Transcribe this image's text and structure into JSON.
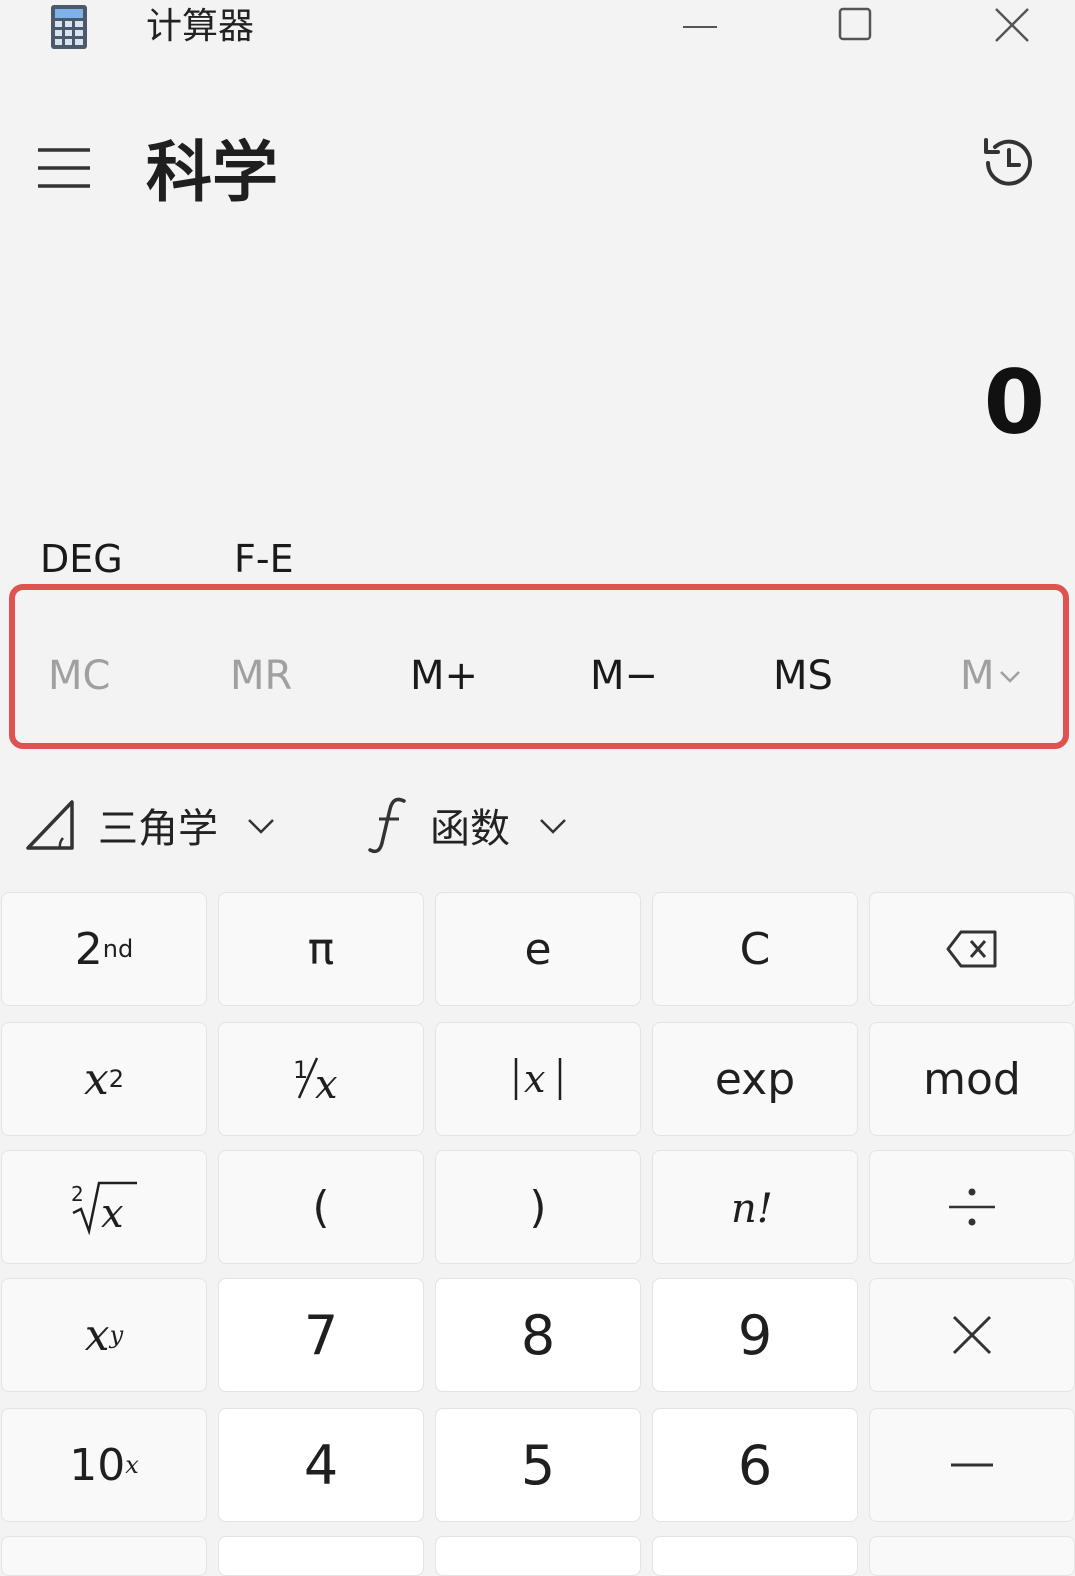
{
  "window": {
    "title": "计算器",
    "icons": [
      "calculator-icon",
      "minimize-icon",
      "maximize-icon",
      "close-icon"
    ]
  },
  "header": {
    "mode": "科学",
    "icons": [
      "hamburger-icon",
      "history-icon"
    ]
  },
  "display": {
    "value": "0"
  },
  "modes": {
    "angle": "DEG",
    "notation": "F-E"
  },
  "memory": {
    "mc": "MC",
    "mr": "MR",
    "mplus": "M+",
    "mminus": "M−",
    "ms": "MS",
    "mlist": "M"
  },
  "functions": {
    "trig": "三角学",
    "func": "函数",
    "icons": [
      "triangle-icon",
      "function-icon",
      "chevron-down-icon"
    ]
  },
  "keys": {
    "pi": "π",
    "e": "e",
    "clear": "C",
    "exp": "exp",
    "mod": "mod",
    "lparen": "(",
    "rparen": ")",
    "seven": "7",
    "eight": "8",
    "nine": "9",
    "four": "4",
    "five": "5",
    "six": "6",
    "second_base": "2",
    "second_sup": "nd",
    "square_base": "x",
    "square_sup": "2",
    "power_base": "x",
    "power_sup": "y",
    "tenpow_base": "10",
    "tenpow_sup": "x"
  },
  "colors": {
    "background": "#f3f3f3",
    "highlight": "#e0524f",
    "key": "#f9f9f9",
    "number_key": "#ffffff",
    "disabled": "#a0a0a0"
  }
}
